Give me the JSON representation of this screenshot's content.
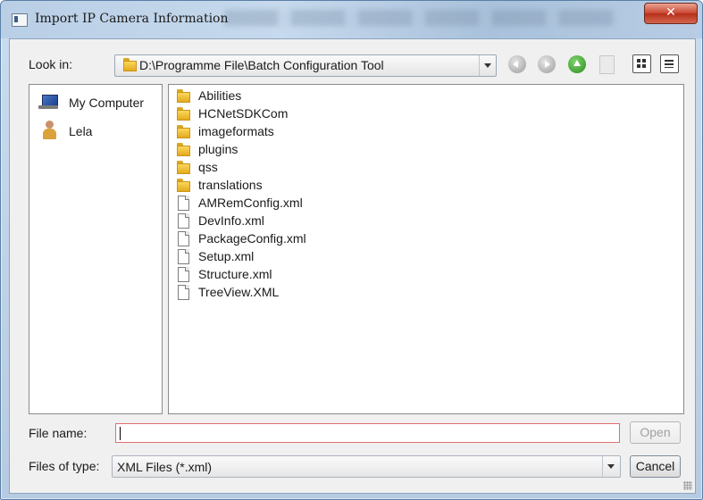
{
  "window": {
    "title": "Import IP Camera Information",
    "close_label": "✕"
  },
  "toolbar": {
    "look_in_label": "Look in:",
    "path": "D:\\Programme File\\Batch Configuration Tool"
  },
  "sidebar": {
    "items": [
      {
        "label": "My Computer",
        "icon": "computer-icon"
      },
      {
        "label": "Lela",
        "icon": "user-folder-icon"
      }
    ]
  },
  "files": [
    {
      "name": "Abilities",
      "type": "folder"
    },
    {
      "name": "HCNetSDKCom",
      "type": "folder"
    },
    {
      "name": "imageformats",
      "type": "folder"
    },
    {
      "name": "plugins",
      "type": "folder"
    },
    {
      "name": "qss",
      "type": "folder"
    },
    {
      "name": "translations",
      "type": "folder"
    },
    {
      "name": "AMRemConfig.xml",
      "type": "file"
    },
    {
      "name": "DevInfo.xml",
      "type": "file"
    },
    {
      "name": "PackageConfig.xml",
      "type": "file"
    },
    {
      "name": "Setup.xml",
      "type": "file"
    },
    {
      "name": "Structure.xml",
      "type": "file"
    },
    {
      "name": "TreeView.XML",
      "type": "file"
    }
  ],
  "footer": {
    "file_name_label": "File name:",
    "file_name_value": "",
    "files_of_type_label": "Files of type:",
    "files_of_type_value": "XML Files (*.xml)",
    "open_label": "Open",
    "cancel_label": "Cancel"
  }
}
